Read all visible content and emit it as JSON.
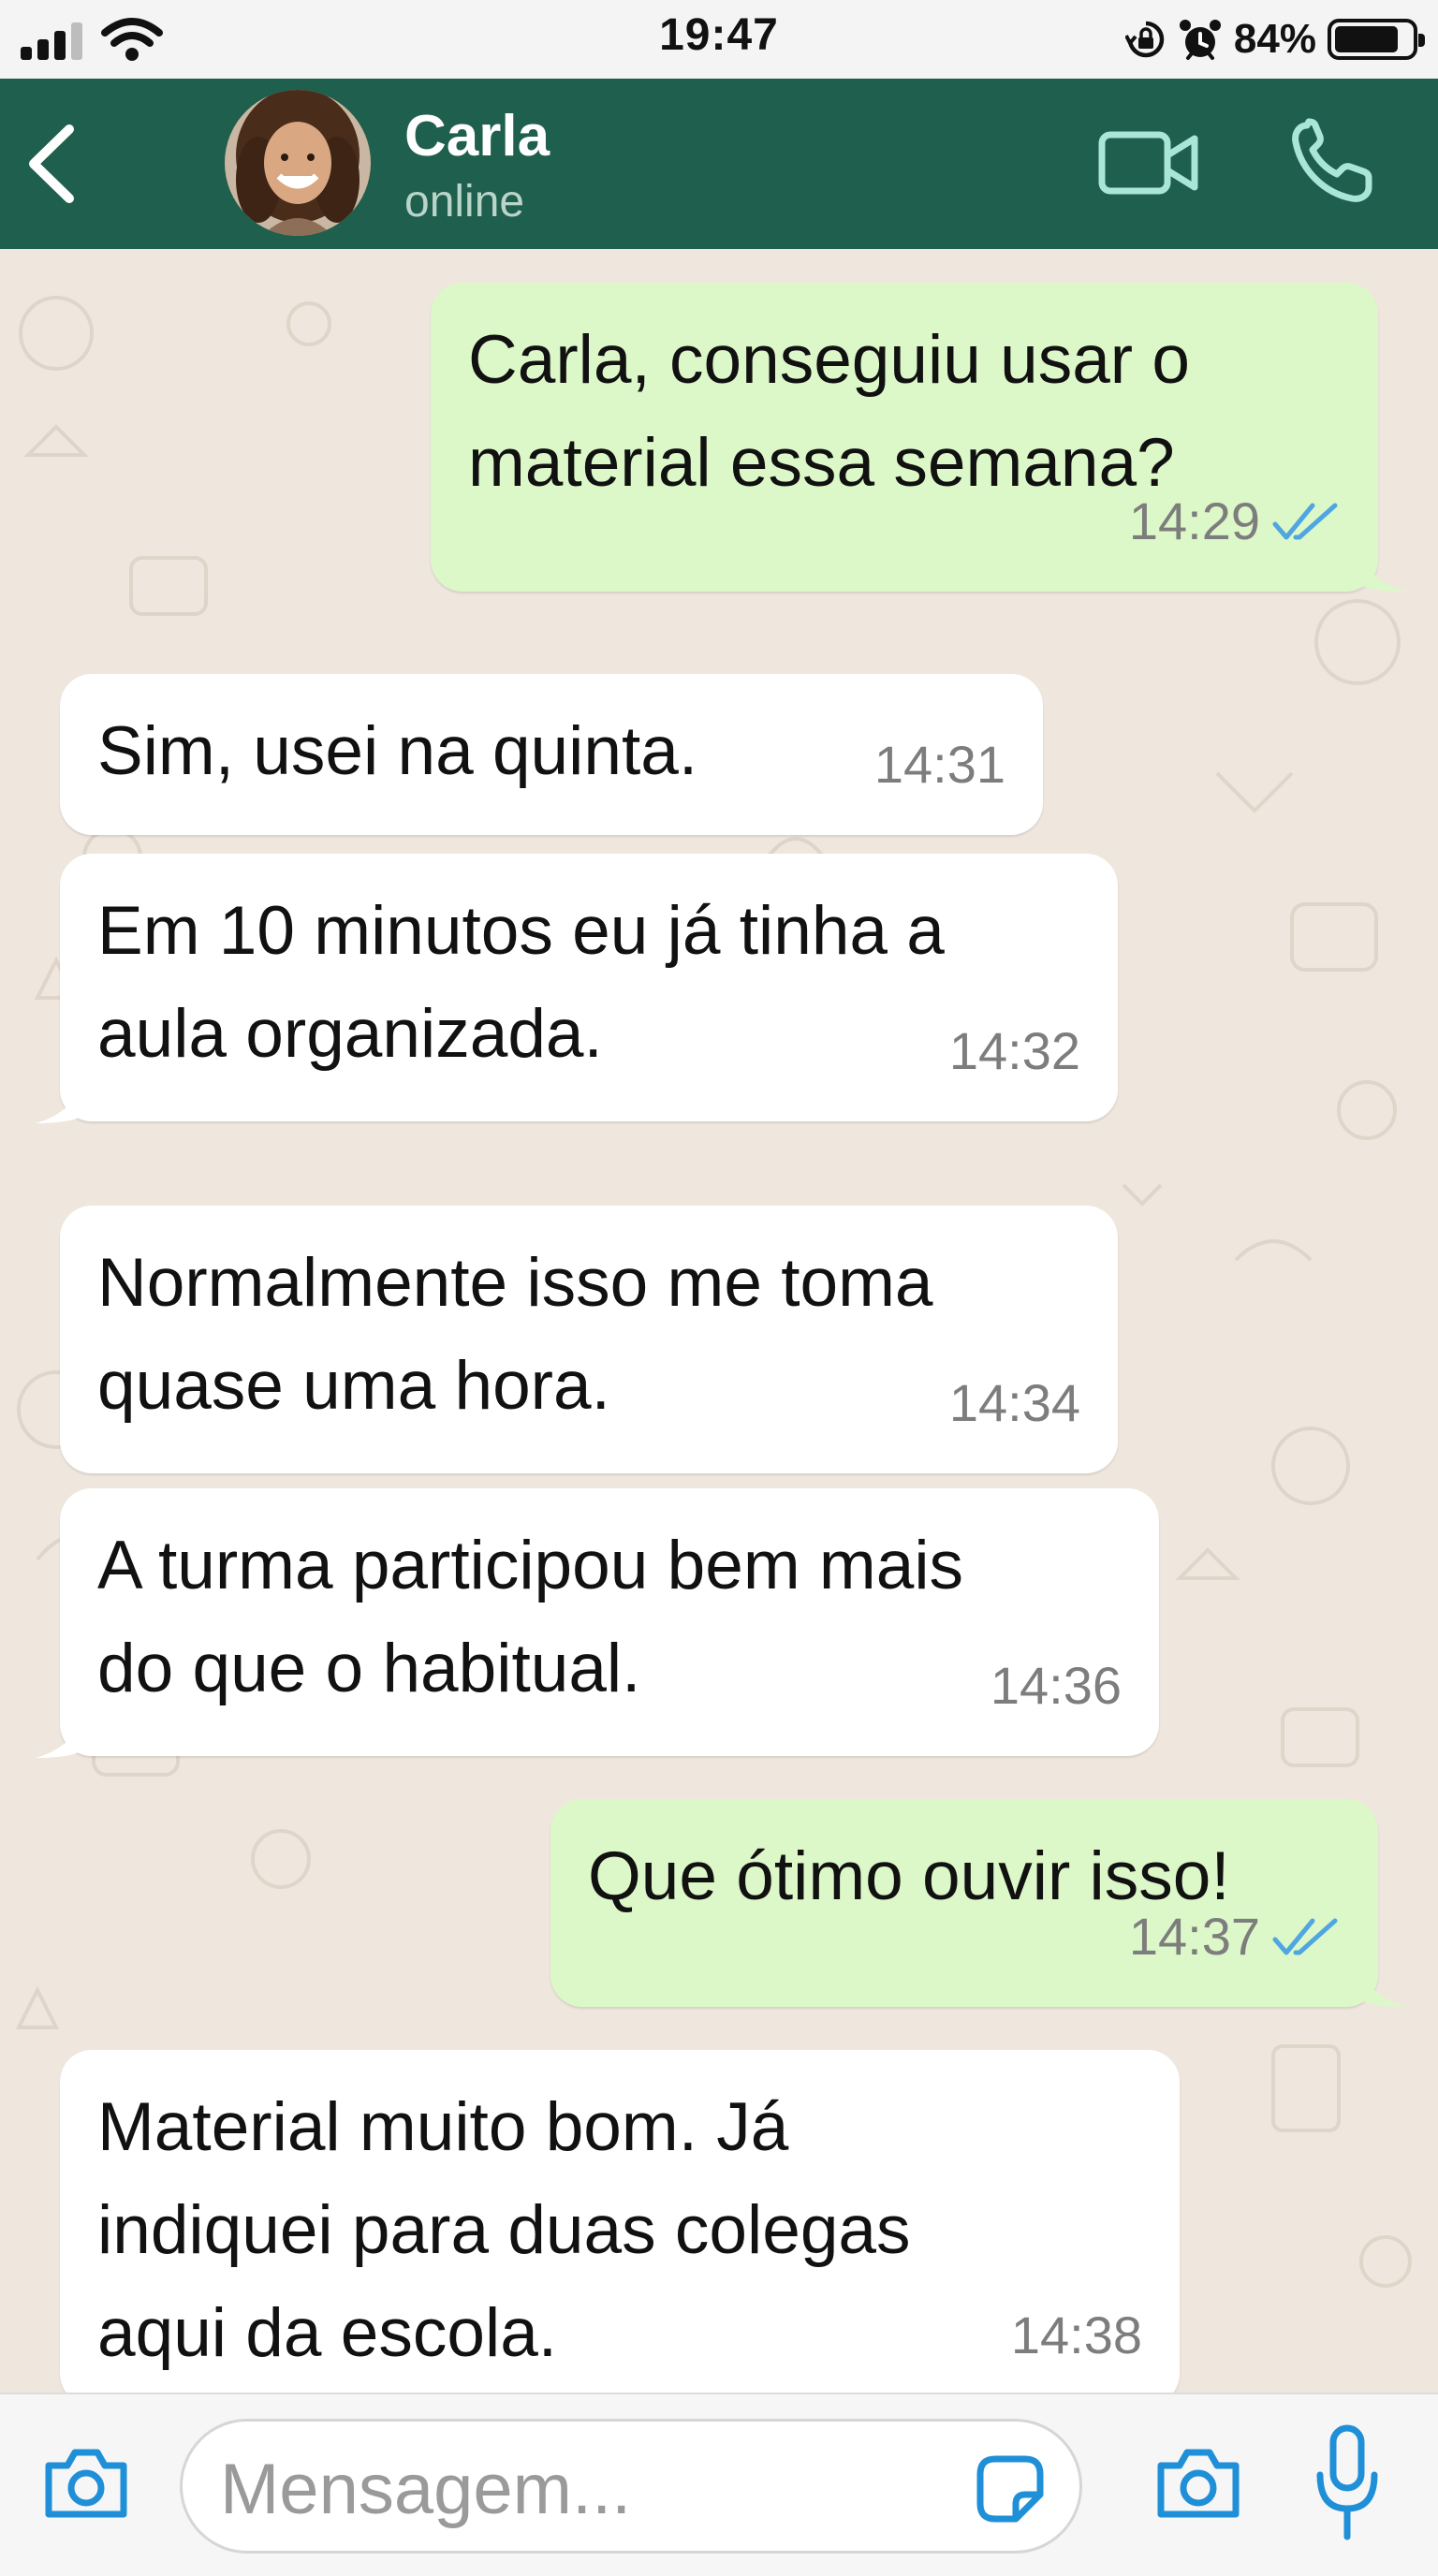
{
  "status_bar": {
    "time": "19:47",
    "battery_percent": "84%",
    "battery_level": 0.84,
    "icons": [
      "signal-icon",
      "wifi-icon",
      "rotation-lock-icon",
      "alarm-icon",
      "battery-icon"
    ]
  },
  "header": {
    "contact_name": "Carla",
    "contact_status": "online",
    "icons": [
      "back-icon",
      "video-call-icon",
      "phone-icon"
    ],
    "color": "#1f5f4d"
  },
  "messages": [
    {
      "direction": "out",
      "text": "Carla, conseguiu usar o\nmaterial essa semana?",
      "time": "14:29",
      "read": true
    },
    {
      "direction": "in",
      "text": "Sim, usei na quinta.",
      "time": "14:31"
    },
    {
      "direction": "in",
      "text": "Em 10 minutos eu já tinha a\naula organizada.",
      "time": "14:32"
    },
    {
      "direction": "in",
      "text": "Normalmente isso me toma\nquase uma hora.",
      "time": "14:34"
    },
    {
      "direction": "in",
      "text": "A turma participou bem mais\ndo que o habitual.",
      "time": "14:36"
    },
    {
      "direction": "out",
      "text": "Que ótimo ouvir isso!",
      "time": "14:37",
      "read": true
    },
    {
      "direction": "in",
      "text": "Material muito bom. Já\nindiquei para duas colegas\naqui da escola.",
      "time": "14:38"
    }
  ],
  "input_bar": {
    "placeholder": "Mensagem...",
    "icons": [
      "camera-icon",
      "sticker-icon",
      "camera-icon",
      "microphone-icon"
    ]
  },
  "colors": {
    "outgoing_bubble": "#dcf8c8",
    "incoming_bubble": "#ffffff",
    "read_ticks": "#4fa6e0",
    "chat_background": "#efe7de"
  }
}
